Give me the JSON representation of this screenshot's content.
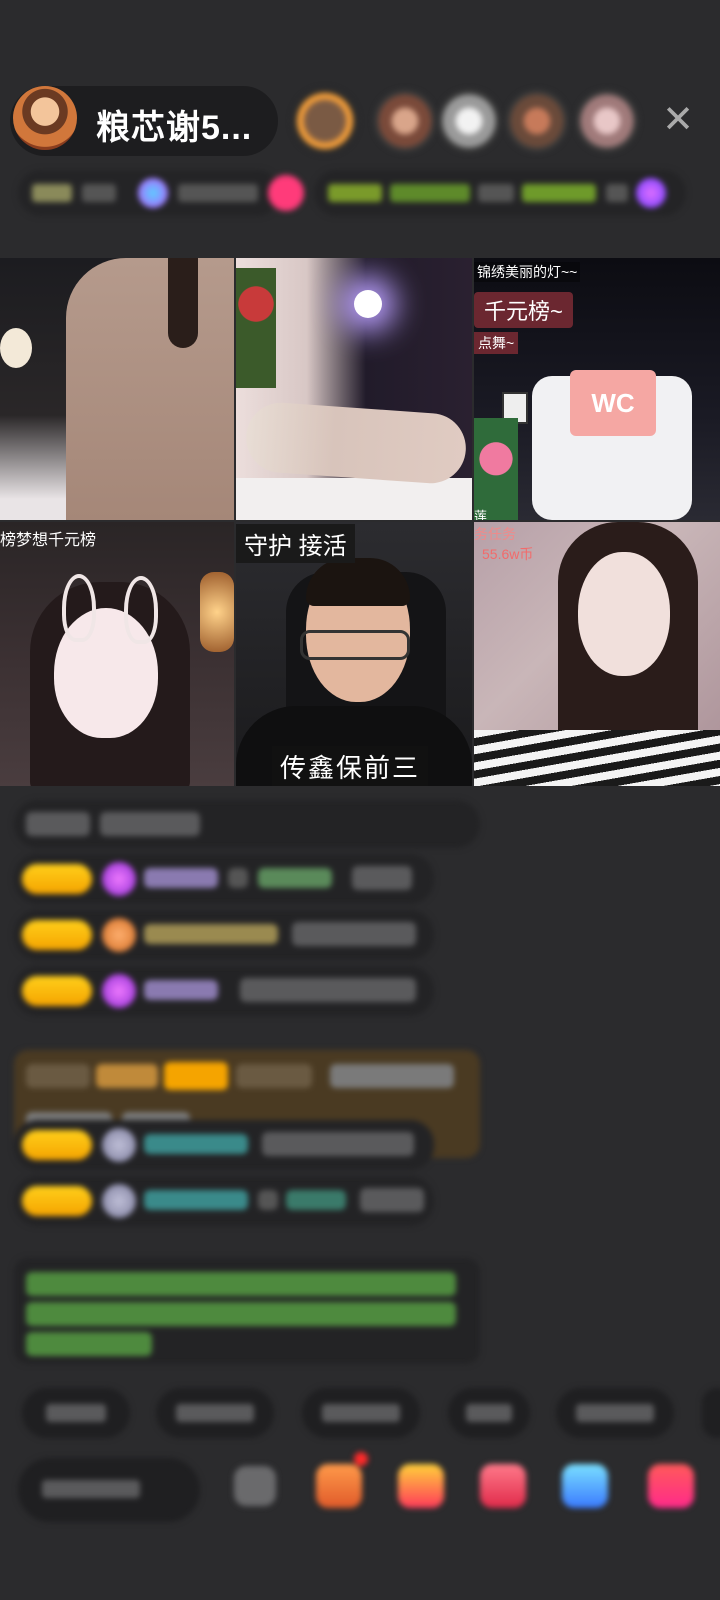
{
  "header": {
    "host_name": "粮芯谢5...",
    "close_glyph": "✕"
  },
  "icons": {
    "close": "close-icon",
    "host_avatar": "avatar",
    "gift": "gift-icon"
  },
  "tiles": {
    "tile3": {
      "label_1": "锦绣美丽的灯~~",
      "label_2": "千元榜~",
      "label_3": "点舞~",
      "label_4": "莲"
    },
    "tile4": {
      "label": "榜梦想千元榜"
    },
    "tile5": {
      "top_label": "守护 接活",
      "bottom_label": "传鑫保前三"
    },
    "tile6": {
      "label_1": "务任务",
      "label_2": "55.6w币"
    },
    "tile3_sign": "WC"
  },
  "colors": {
    "background": "#2b2b2d",
    "badge": "#f5a400",
    "notice_text": "#6fbf58",
    "gift_bg": "#4a3a22"
  }
}
